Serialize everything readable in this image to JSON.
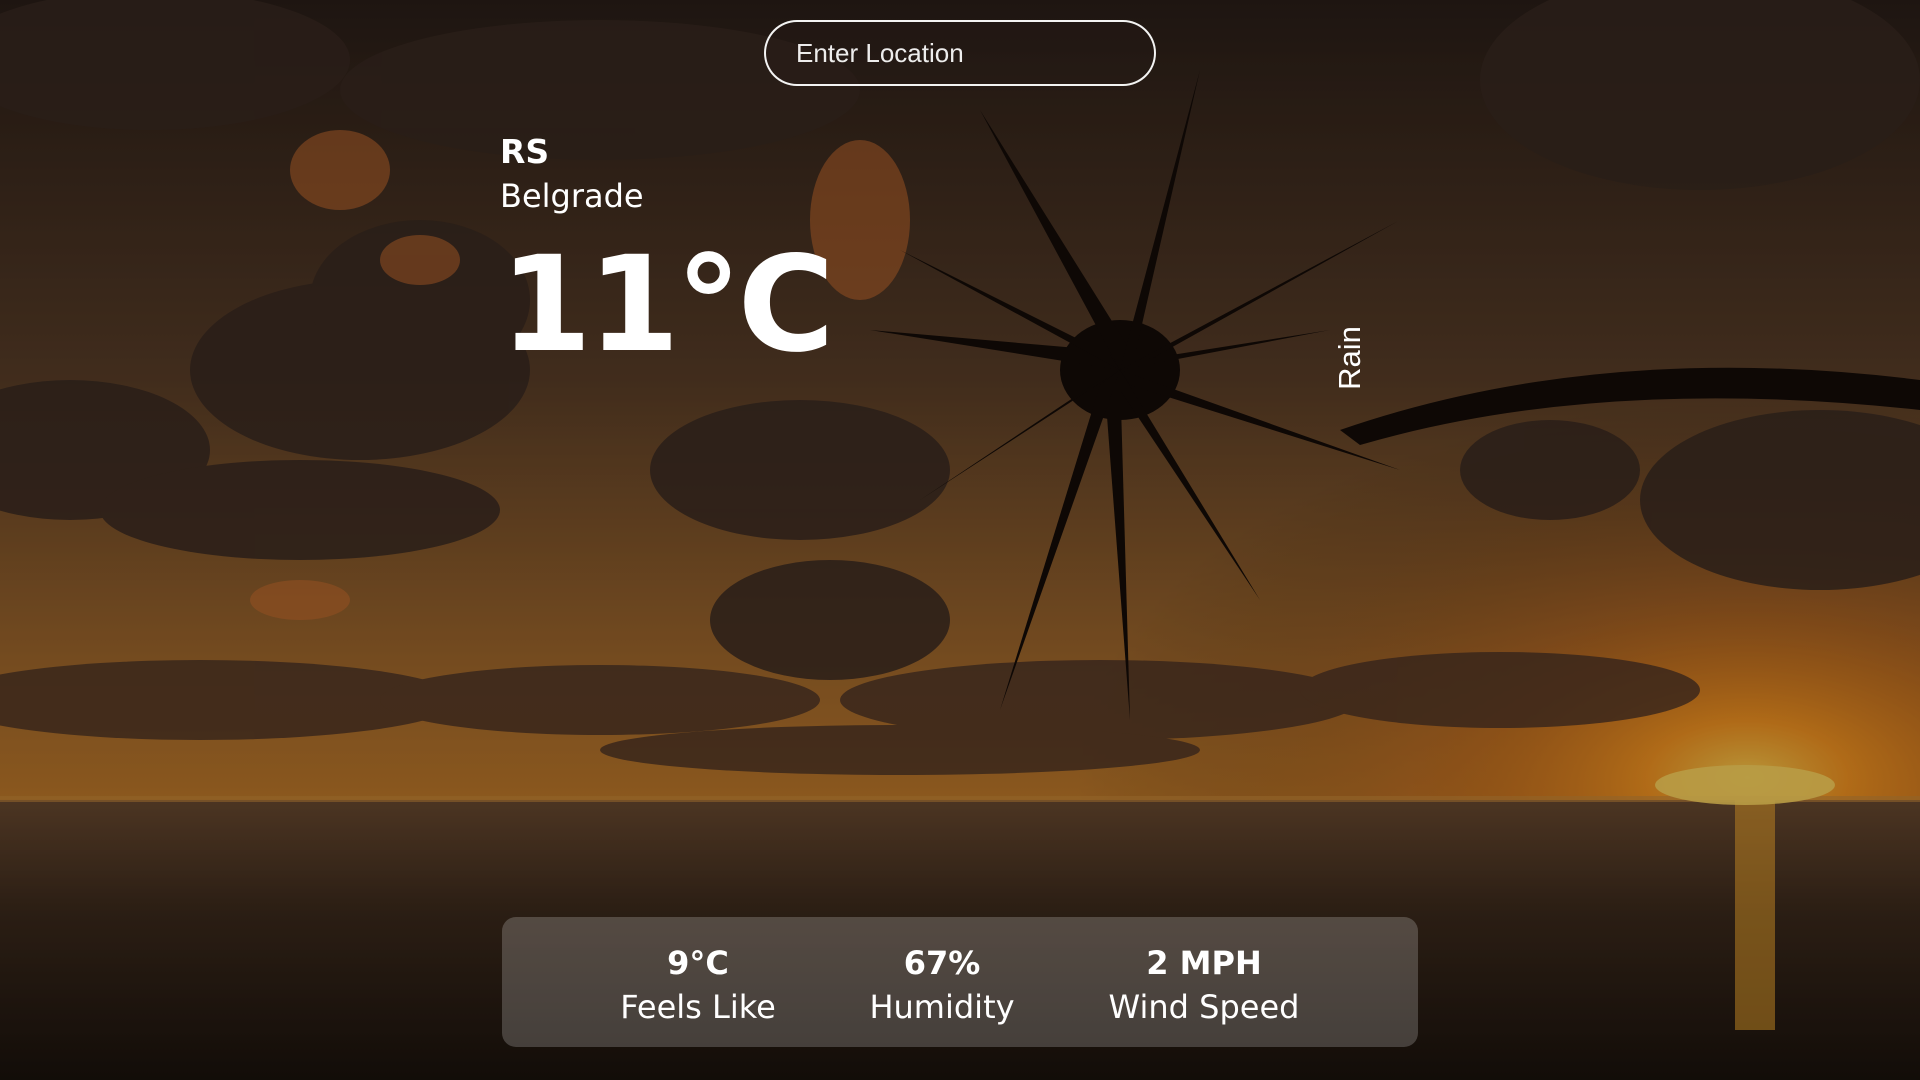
{
  "search": {
    "placeholder": "Enter Location",
    "value": ""
  },
  "location": {
    "country": "RS",
    "city": "Belgrade"
  },
  "weather": {
    "temperature": "11°C",
    "condition": "Rain"
  },
  "stats": {
    "feels_like": {
      "value": "9°C",
      "label": "Feels Like"
    },
    "humidity": {
      "value": "67%",
      "label": "Humidity"
    },
    "wind_speed": {
      "value": "2 MPH",
      "label": "Wind Speed"
    }
  },
  "background": {
    "description_icon": "sunset-beach-palm-image",
    "sky_top": "#3a2a20",
    "sky_mid": "#8a5a2a",
    "sun": "#ffb020",
    "sea": "#2e2218"
  }
}
